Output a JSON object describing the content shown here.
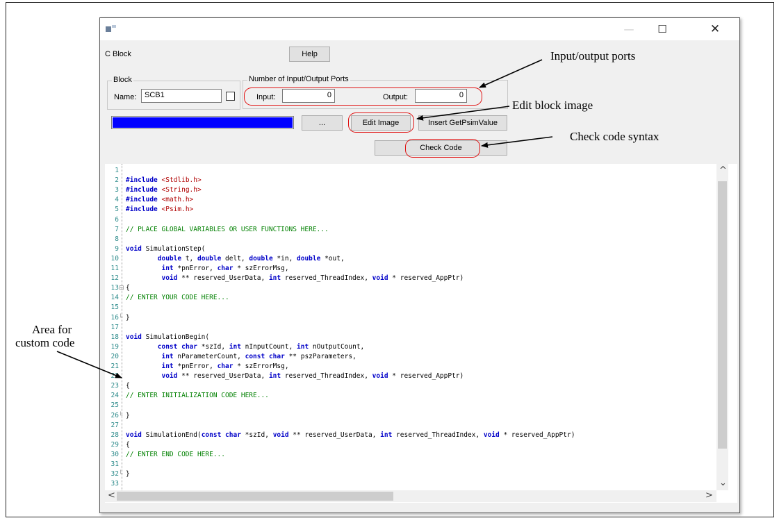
{
  "window": {
    "dialog_title": "C Block",
    "help_label": "Help",
    "controls": {
      "minimize": "—",
      "maximize": "☐",
      "close": "✕"
    }
  },
  "block_group": {
    "title": "Block",
    "name_label": "Name:",
    "name_value": "SCB1"
  },
  "ports_group": {
    "title": "Number of Input/Output Ports",
    "input_label": "Input:",
    "input_value": "0",
    "output_label": "Output:",
    "output_value": "0"
  },
  "progress": {
    "percent": 100,
    "color": "#0000ff"
  },
  "buttons": {
    "browse": "...",
    "edit_image": "Edit Image",
    "insert_getpsimvalue": "Insert GetPsimValue",
    "check_code": "Check Code"
  },
  "editor": {
    "lines": [
      {
        "n": "1",
        "fold": "",
        "t": ""
      },
      {
        "n": "2",
        "fold": "",
        "t": "#include <Stdlib.h>"
      },
      {
        "n": "3",
        "fold": "",
        "t": "#include <String.h>"
      },
      {
        "n": "4",
        "fold": "",
        "t": "#include <math.h>"
      },
      {
        "n": "5",
        "fold": "",
        "t": "#include <Psim.h>"
      },
      {
        "n": "6",
        "fold": "",
        "t": ""
      },
      {
        "n": "7",
        "fold": "",
        "t": "// PLACE GLOBAL VARIABLES OR USER FUNCTIONS HERE..."
      },
      {
        "n": "8",
        "fold": "",
        "t": ""
      },
      {
        "n": "9",
        "fold": "",
        "t": "void SimulationStep("
      },
      {
        "n": "10",
        "fold": "",
        "t": "        double t, double delt, double *in, double *out,"
      },
      {
        "n": "11",
        "fold": "",
        "t": "         int *pnError, char * szErrorMsg,"
      },
      {
        "n": "12",
        "fold": "",
        "t": "         void ** reserved_UserData, int reserved_ThreadIndex, void * reserved_AppPtr)"
      },
      {
        "n": "13",
        "fold": "⊟",
        "t": "{"
      },
      {
        "n": "14",
        "fold": "",
        "t": "// ENTER YOUR CODE HERE..."
      },
      {
        "n": "15",
        "fold": "",
        "t": ""
      },
      {
        "n": "16",
        "fold": "└",
        "t": "}"
      },
      {
        "n": "17",
        "fold": "",
        "t": ""
      },
      {
        "n": "18",
        "fold": "",
        "t": "void SimulationBegin("
      },
      {
        "n": "19",
        "fold": "",
        "t": "        const char *szId, int nInputCount, int nOutputCount,"
      },
      {
        "n": "20",
        "fold": "",
        "t": "         int nParameterCount, const char ** pszParameters,"
      },
      {
        "n": "21",
        "fold": "",
        "t": "         int *pnError, char * szErrorMsg,"
      },
      {
        "n": "22",
        "fold": "",
        "t": "         void ** reserved_UserData, int reserved_ThreadIndex, void * reserved_AppPtr)"
      },
      {
        "n": "23",
        "fold": "",
        "t": "{"
      },
      {
        "n": "24",
        "fold": "",
        "t": "// ENTER INITIALIZATION CODE HERE..."
      },
      {
        "n": "25",
        "fold": "",
        "t": ""
      },
      {
        "n": "26",
        "fold": "└",
        "t": "}"
      },
      {
        "n": "27",
        "fold": "",
        "t": ""
      },
      {
        "n": "28",
        "fold": "",
        "t": "void SimulationEnd(const char *szId, void ** reserved_UserData, int reserved_ThreadIndex, void * reserved_AppPtr)"
      },
      {
        "n": "29",
        "fold": "",
        "t": "{"
      },
      {
        "n": "30",
        "fold": "",
        "t": "// ENTER END CODE HERE..."
      },
      {
        "n": "31",
        "fold": "",
        "t": ""
      },
      {
        "n": "32",
        "fold": "└",
        "t": "}"
      },
      {
        "n": "33",
        "fold": "",
        "t": ""
      }
    ],
    "colors": {
      "keyword": "#0000c8",
      "string": "#b00000",
      "comment": "#008000",
      "line_number": "#2b8a8a"
    }
  },
  "scrollbars": {
    "up": "^",
    "down": "⌄",
    "left": "<",
    "right": ">"
  },
  "annotations": {
    "ports": "Input/output ports",
    "edit_image": "Edit block image",
    "check_code": "Check code syntax",
    "custom_code_1": "Area for",
    "custom_code_2": "custom code"
  },
  "highlight_color": "#e01010"
}
